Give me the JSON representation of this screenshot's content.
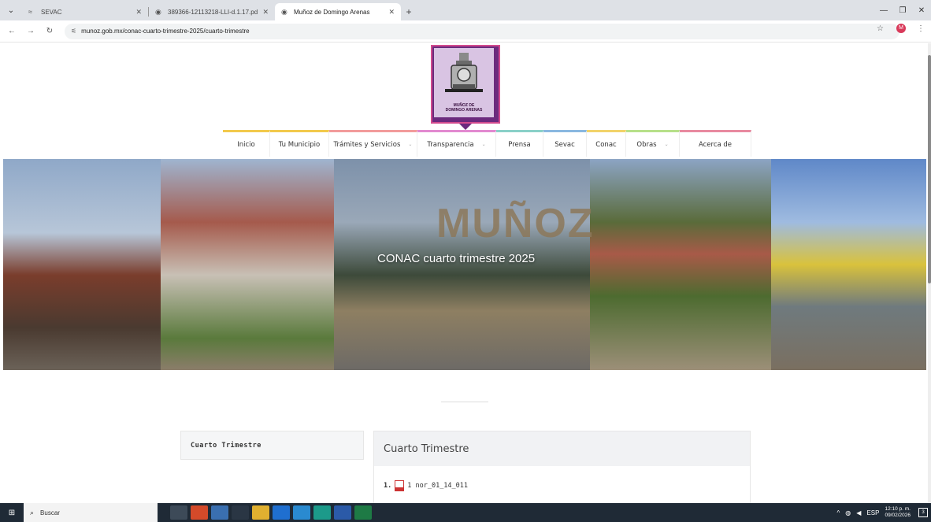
{
  "browser": {
    "tabs": [
      {
        "label": "SEVAC",
        "icon": "signal-icon"
      },
      {
        "label": "389366-12113218-LLI-d.1.17.pd",
        "icon": "globe-icon"
      },
      {
        "label": "Muñoz de Domingo Arenas",
        "icon": "globe-icon"
      }
    ],
    "url": "munoz.gob.mx/conac-cuarto-trimestre-2025/cuarto-trimestre",
    "profile_initial": "M"
  },
  "logo": {
    "line1": "MUÑOZ DE",
    "line2": "DOMINGO ARENAS"
  },
  "menu": [
    {
      "label": "Inicio",
      "color": "#f2c94c",
      "dropdown": false
    },
    {
      "label": "Tu Municipio",
      "color": "#f2c94c",
      "dropdown": false
    },
    {
      "label": "Trámites y Servicios",
      "color": "#f29b9b",
      "dropdown": true
    },
    {
      "label": "Transparencia",
      "color": "#e28ad0",
      "dropdown": true
    },
    {
      "label": "Prensa",
      "color": "#8ad0c8",
      "dropdown": false
    },
    {
      "label": "Sevac",
      "color": "#8ab8e0",
      "dropdown": false
    },
    {
      "label": "Conac",
      "color": "#f2d36a",
      "dropdown": false
    },
    {
      "label": "Obras",
      "color": "#b7e08a",
      "dropdown": true
    },
    {
      "label": "Acerca de",
      "color": "#e88aa0",
      "dropdown": false
    }
  ],
  "hero": {
    "title": "CONAC cuarto trimestre 2025",
    "sign_text": "MUÑOZ"
  },
  "sidebar": {
    "card_label": "Cuarto Trimestre"
  },
  "content": {
    "heading": "Cuarto Trimestre",
    "files": [
      {
        "number": "1.",
        "name": "1 nor_01_14_011"
      }
    ]
  },
  "taskbar": {
    "search_placeholder": "Buscar",
    "language": "ESP",
    "time": "12:10 p. m.",
    "date": "09/02/2026",
    "notifications": "3"
  }
}
